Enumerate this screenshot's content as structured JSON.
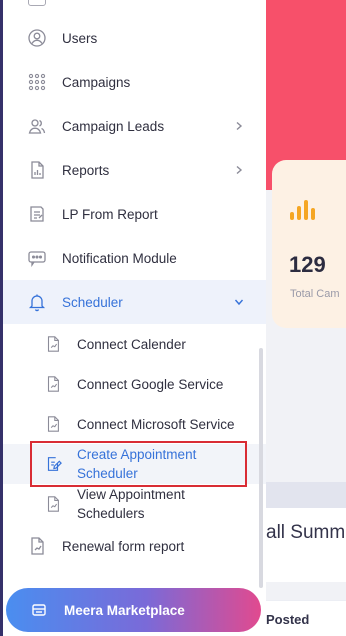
{
  "sidebar": {
    "items": [
      {
        "label": "Users",
        "icon": "users-icon"
      },
      {
        "label": "Campaigns",
        "icon": "grid-dots-icon"
      },
      {
        "label": "Campaign Leads",
        "icon": "leads-icon",
        "has_submenu": true
      },
      {
        "label": "Reports",
        "icon": "report-icon",
        "has_submenu": true
      },
      {
        "label": "LP From Report",
        "icon": "lp-report-icon"
      },
      {
        "label": "Notification Module",
        "icon": "message-icon"
      },
      {
        "label": "Scheduler",
        "icon": "bell-icon",
        "has_submenu": true,
        "expanded": true
      },
      {
        "label": "Renewal form report",
        "icon": "report-icon"
      }
    ],
    "scheduler_subitems": [
      {
        "label": "Connect Calender"
      },
      {
        "label": "Connect Google Service"
      },
      {
        "label": "Connect Microsoft Service"
      },
      {
        "label": "Create Appointment Scheduler",
        "selected": true
      },
      {
        "label": "View Appointment Schedulers"
      }
    ],
    "marketplace": {
      "label": "Meera Marketplace",
      "icon": "store-icon"
    }
  },
  "dashboard": {
    "stat_value": "129",
    "stat_label": "Total Cam",
    "summary_title": "all Summ",
    "table_header": "Posted"
  },
  "colors": {
    "accent": "#3672d9",
    "hero": "#f7506a",
    "highlight": "#d92c34",
    "marketplace_gradient": [
      "#4a8ef0",
      "#e14a8f"
    ]
  }
}
